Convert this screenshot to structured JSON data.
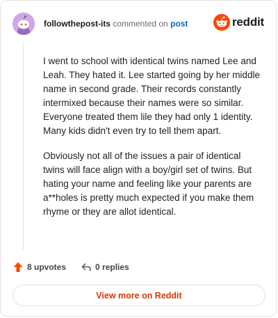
{
  "header": {
    "author": "followthepost-its",
    "action_text": "commented on",
    "post_link": "post",
    "brand": "reddit"
  },
  "comment": {
    "paragraphs": [
      "I went to school with identical twins named Lee and Leah. They hated it. Lee started going by her middle name in second grade. Their records constantly intermixed because their names were so similar. Everyone treated them lile they had only 1 identity. Many kids didn't even try to tell them apart.",
      "Obviously not all of the issues a pair of identical twins will face align with a boy/girl set of twins. But hating your name and feeling like your parents are a**holes is pretty much expected if you make them rhyme or they are allot identical."
    ]
  },
  "actions": {
    "upvotes": "8 upvotes",
    "replies": "0 replies"
  },
  "footer": {
    "view_button": "View more on Reddit"
  },
  "colors": {
    "upvote": "#ff4500",
    "link": "#0a66c2",
    "view_button_text": "#d93a00",
    "avatar_bg": "#cfa6e6"
  },
  "icons": {
    "avatar": "snoo-avatar-icon",
    "logo": "reddit-logo-icon",
    "upvote": "upvote-arrow-icon",
    "reply": "reply-arrow-icon"
  }
}
